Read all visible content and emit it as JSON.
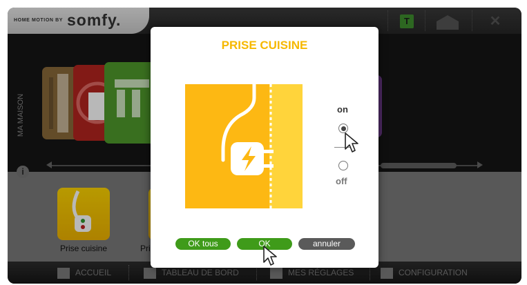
{
  "header": {
    "brand_small": "HOME MOTION BY",
    "brand_name": "somfy.",
    "icons": [
      "t-icon",
      "home-icon",
      "close-icon"
    ],
    "t_label": "T"
  },
  "stage": {
    "side_label": "MA MAISON"
  },
  "devices": [
    {
      "label": "Prise cuisine"
    },
    {
      "label": "Pri"
    }
  ],
  "bottom_nav": {
    "items": [
      {
        "label": "ACCUEIL",
        "icon": "home-icon"
      },
      {
        "label": "TABLEAU DE BORD",
        "icon": "dashboard-icon"
      },
      {
        "label": "MES RÉGLAGES",
        "icon": "user-icon"
      },
      {
        "label": "CONFIGURATION",
        "icon": "gear-icon"
      }
    ]
  },
  "modal": {
    "title": "PRISE CUISINE",
    "on_label": "on",
    "off_label": "off",
    "selected_state": "on",
    "buttons": {
      "ok_all": "OK tous",
      "ok": "OK",
      "cancel": "annuler"
    }
  },
  "colors": {
    "accent_yellow": "#f6b800",
    "button_green": "#3f9b1a",
    "button_grey": "#5a5a5a"
  }
}
